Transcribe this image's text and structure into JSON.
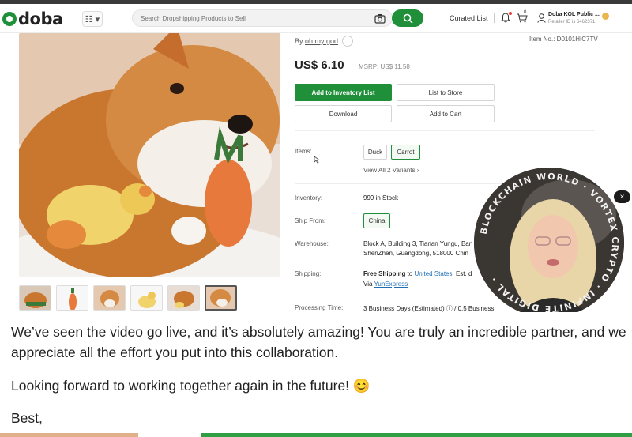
{
  "header": {
    "logo_text": "doba",
    "menu_label": "☷ ▾",
    "search_placeholder": "Search Dropshipping Products to Sell",
    "curated_list": "Curated List",
    "cart_count": "0",
    "user_name": "Doba KOL Public ...",
    "retailer_id": "Retailer ID is 6462371"
  },
  "product": {
    "by_prefix": "By",
    "seller": "oh my god",
    "item_no": "Item No.: D0101HIC7TV",
    "price": "US$ 6.10",
    "msrp": "MSRP: US$ 11.58",
    "buttons": {
      "add_inventory": "Add to Inventory List",
      "list_store": "List to Store",
      "download": "Download",
      "add_cart": "Add to Cart"
    },
    "items_label": "Items:",
    "variants": [
      "Duck",
      "Carrot"
    ],
    "selected_variant": "Carrot",
    "view_all": "View All 2 Variants",
    "inventory_label": "Inventory:",
    "inventory_value": "999 in Stock",
    "ship_from_label": "Ship From:",
    "ship_from_value": "China",
    "warehouse_label": "Warehouse:",
    "warehouse_line1": "Block A, Building 3, Tianan Yungu, Ban",
    "warehouse_line2": "ShenZhen, Guangdong, 518000 Chin",
    "shipping_label": "Shipping:",
    "shipping_free": "Free Shipping",
    "shipping_to": "to",
    "shipping_country": "United States",
    "shipping_est": ", Est. d",
    "shipping_via": "Via",
    "shipping_carrier": "YunExpress",
    "processing_label": "Processing Time:",
    "processing_value": "3 Business Days (Estimated) ⓘ / 0.5 Business"
  },
  "webcam": {
    "ring_text": "BLOCKCHAIN WORLD · VORTEX CRYPTO · INFINITE DIGITAL ·",
    "close_label": "×"
  },
  "email": {
    "paragraph1": "We’ve seen the video go live, and it’s absolutely amazing! You are truly an incredible partner, and we appreciate all the effort you put into this collaboration.",
    "paragraph2": "Looking forward to working together again in the future! 😊",
    "paragraph3": "Best,"
  },
  "colors": {
    "brand_green": "#1f8f3a",
    "header_strip": "#3a3a3a",
    "badge_red": "#e53935"
  }
}
